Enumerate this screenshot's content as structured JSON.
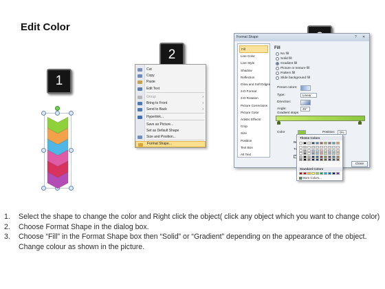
{
  "page": {
    "title": "Edit Color"
  },
  "badges": [
    "1",
    "2",
    "3"
  ],
  "context_menu": {
    "items": [
      {
        "label": "Cut",
        "icon": "scissors-icon",
        "disabled": false,
        "submenu": false
      },
      {
        "label": "Copy",
        "icon": "copy-icon",
        "disabled": false,
        "submenu": false
      },
      {
        "label": "Paste",
        "icon": "paste-icon",
        "disabled": false,
        "submenu": false
      },
      {
        "label": "Edit Text",
        "icon": "edit-text-icon",
        "disabled": false,
        "submenu": false
      },
      {
        "label": "Group",
        "icon": "group-icon",
        "disabled": true,
        "submenu": true
      },
      {
        "label": "Bring to Front",
        "icon": "bring-front-icon",
        "disabled": false,
        "submenu": true
      },
      {
        "label": "Send to Back",
        "icon": "send-back-icon",
        "disabled": false,
        "submenu": true
      },
      {
        "label": "Hyperlink...",
        "icon": "hyperlink-icon",
        "disabled": false,
        "submenu": false
      },
      {
        "label": "Save as Picture...",
        "icon": "",
        "disabled": false,
        "submenu": false
      },
      {
        "label": "Set as Default Shape",
        "icon": "",
        "disabled": false,
        "submenu": false
      },
      {
        "label": "Size and Position...",
        "icon": "size-position-icon",
        "disabled": false,
        "submenu": false
      },
      {
        "label": "Format Shape...",
        "icon": "format-shape-icon",
        "disabled": false,
        "submenu": false,
        "highlighted": true
      }
    ]
  },
  "dialog": {
    "title": "Format Shape",
    "title_controls": [
      "?",
      "✕"
    ],
    "nav": [
      "Fill",
      "Line Color",
      "Line Style",
      "Shadow",
      "Reflection",
      "Glow and Soft Edges",
      "3-D Format",
      "3-D Rotation",
      "Picture Corrections",
      "Picture Color",
      "Artistic Effects",
      "Crop",
      "Size",
      "Position",
      "Text Box",
      "Alt Text"
    ],
    "selected_nav": "Fill",
    "fill_heading": "Fill",
    "fill_options": [
      {
        "label": "No fill",
        "selected": false
      },
      {
        "label": "Solid fill",
        "selected": false
      },
      {
        "label": "Gradient fill",
        "selected": true
      },
      {
        "label": "Picture or texture fill",
        "selected": false
      },
      {
        "label": "Pattern fill",
        "selected": false
      },
      {
        "label": "Slide background fill",
        "selected": false
      }
    ],
    "preset_colors_label": "Preset colors:",
    "type_label": "Type:",
    "type_value": "Linear",
    "direction_label": "Direction:",
    "angle_label": "Angle:",
    "angle_value": "45°",
    "gradient_stops_label": "Gradient stops",
    "color_label": "Color",
    "position_label": "Position:",
    "position_value": "0%",
    "brightness_label": "Brightness",
    "transparency_label": "Transparency",
    "rotate_label": "Rotate with shape",
    "close_label": "Close"
  },
  "colors_popup": {
    "theme_header": "Theme Colors",
    "standard_header": "Standard Colors",
    "more_colors": "More Colors...",
    "theme_top_row": [
      "#ffffff",
      "#000000",
      "#eeece1",
      "#1f497d",
      "#4f81bd",
      "#c0504d",
      "#9bbb59",
      "#8064a2",
      "#4bacc6",
      "#f79646"
    ],
    "standard_row": [
      "#c00000",
      "#ff0000",
      "#ffc000",
      "#ffff00",
      "#92d050",
      "#00b050",
      "#00b0f0",
      "#0070c0",
      "#002060",
      "#7030a0"
    ]
  },
  "shape_colors": [
    "#8fd13a",
    "#f3a24a",
    "#4fb7e6",
    "#e05aa6",
    "#d8335e",
    "#b44cb8"
  ],
  "instructions": [
    {
      "num": "1.",
      "text": "Select the shape to change the color and Right click the object( click any object which you want to change color)"
    },
    {
      "num": "2.",
      "text": "Choose Format Shape in the dialog box."
    },
    {
      "num": "3.",
      "text": "Choose “Fill” in the Format Shape box then “Solid” or “Gradient” depending on the appearance of the object. Change colour as shown in the picture."
    }
  ]
}
